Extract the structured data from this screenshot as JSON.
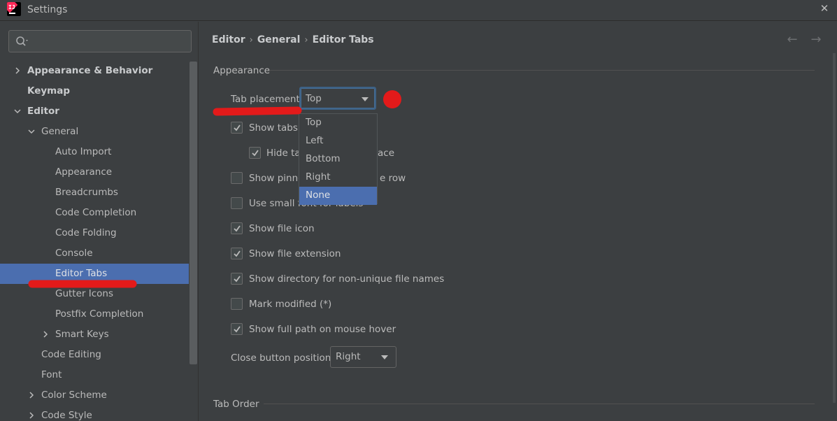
{
  "window": {
    "title": "Settings"
  },
  "search": {
    "placeholder": "",
    "value": ""
  },
  "tree": {
    "items": [
      {
        "label": "Appearance & Behavior",
        "expanded": false
      },
      {
        "label": "Keymap"
      },
      {
        "label": "Editor",
        "expanded": true
      },
      {
        "label": "General",
        "expanded": true
      },
      {
        "label": "Auto Import"
      },
      {
        "label": "Appearance"
      },
      {
        "label": "Breadcrumbs"
      },
      {
        "label": "Code Completion"
      },
      {
        "label": "Code Folding"
      },
      {
        "label": "Console"
      },
      {
        "label": "Editor Tabs",
        "selected": true
      },
      {
        "label": "Gutter Icons"
      },
      {
        "label": "Postfix Completion"
      },
      {
        "label": "Smart Keys",
        "expanded": false
      },
      {
        "label": "Code Editing"
      },
      {
        "label": "Font"
      },
      {
        "label": "Color Scheme",
        "expanded": false
      },
      {
        "label": "Code Style",
        "expanded": false
      }
    ]
  },
  "breadcrumb": {
    "items": [
      "Editor",
      "General",
      "Editor Tabs"
    ]
  },
  "appearance_section": {
    "title": "Appearance",
    "tab_placement_label": "Tab placement:",
    "tab_placement_value": "Top",
    "tab_placement_options": [
      "Top",
      "Left",
      "Bottom",
      "Right",
      "None"
    ],
    "highlighted_option": "None",
    "options": [
      {
        "label": "Show tabs i",
        "checked": true
      },
      {
        "label": "Hide ta",
        "label_tail": "ace",
        "checked": true
      },
      {
        "label": "Show pinne",
        "label_tail": "e row",
        "checked": false
      },
      {
        "label": "Use small font for labels",
        "checked": false
      },
      {
        "label": "Show file icon",
        "checked": true
      },
      {
        "label": "Show file extension",
        "checked": true
      },
      {
        "label": "Show directory for non-unique file names",
        "checked": true
      },
      {
        "label": "Mark modified (*)",
        "checked": false
      },
      {
        "label": "Show full path on mouse hover",
        "checked": true
      }
    ],
    "close_button_label": "Close button position:",
    "close_button_value": "Right"
  },
  "tab_order_section": {
    "title": "Tab Order"
  },
  "colors": {
    "selection": "#4b6eaf",
    "annotation_red": "#e31a1a"
  }
}
